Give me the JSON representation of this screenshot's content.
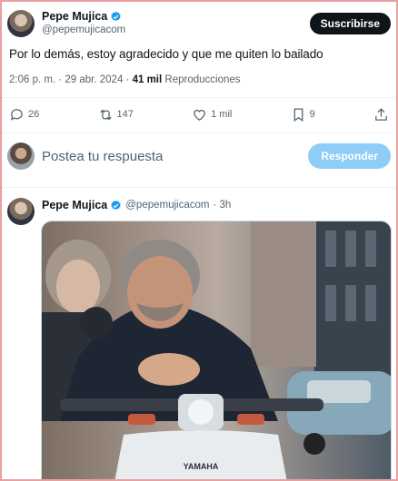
{
  "tweet": {
    "author_name": "Pepe Mujica",
    "author_handle": "@pepemujicacom",
    "subscribe_label": "Suscribirse",
    "text": "Por lo demás, estoy agradecido y que me quiten lo bailado",
    "time": "2:06 p. m.",
    "date": "29 abr. 2024",
    "views_count": "41 mil",
    "views_label": "Reproducciones",
    "separator": "·"
  },
  "actions": {
    "replies": "26",
    "retweets": "147",
    "likes": "1 mil",
    "bookmarks": "9"
  },
  "reply_box": {
    "placeholder": "Postea tu respuesta",
    "button_label": "Responder"
  },
  "reply_tweet": {
    "author_name": "Pepe Mujica",
    "author_handle": "@pepemujicacom",
    "age": "· 3h",
    "image_text": "YAMAHA"
  },
  "icons": {
    "verified": "verified-badge-icon",
    "reply": "reply-icon",
    "retweet": "retweet-icon",
    "like": "heart-icon",
    "bookmark": "bookmark-icon",
    "share": "share-icon"
  },
  "colors": {
    "verified": "#1d9bf0",
    "text": "#0f1419",
    "muted": "#536471",
    "reply_button": "#8ecdf8",
    "subscribe_button": "#0f1419"
  }
}
